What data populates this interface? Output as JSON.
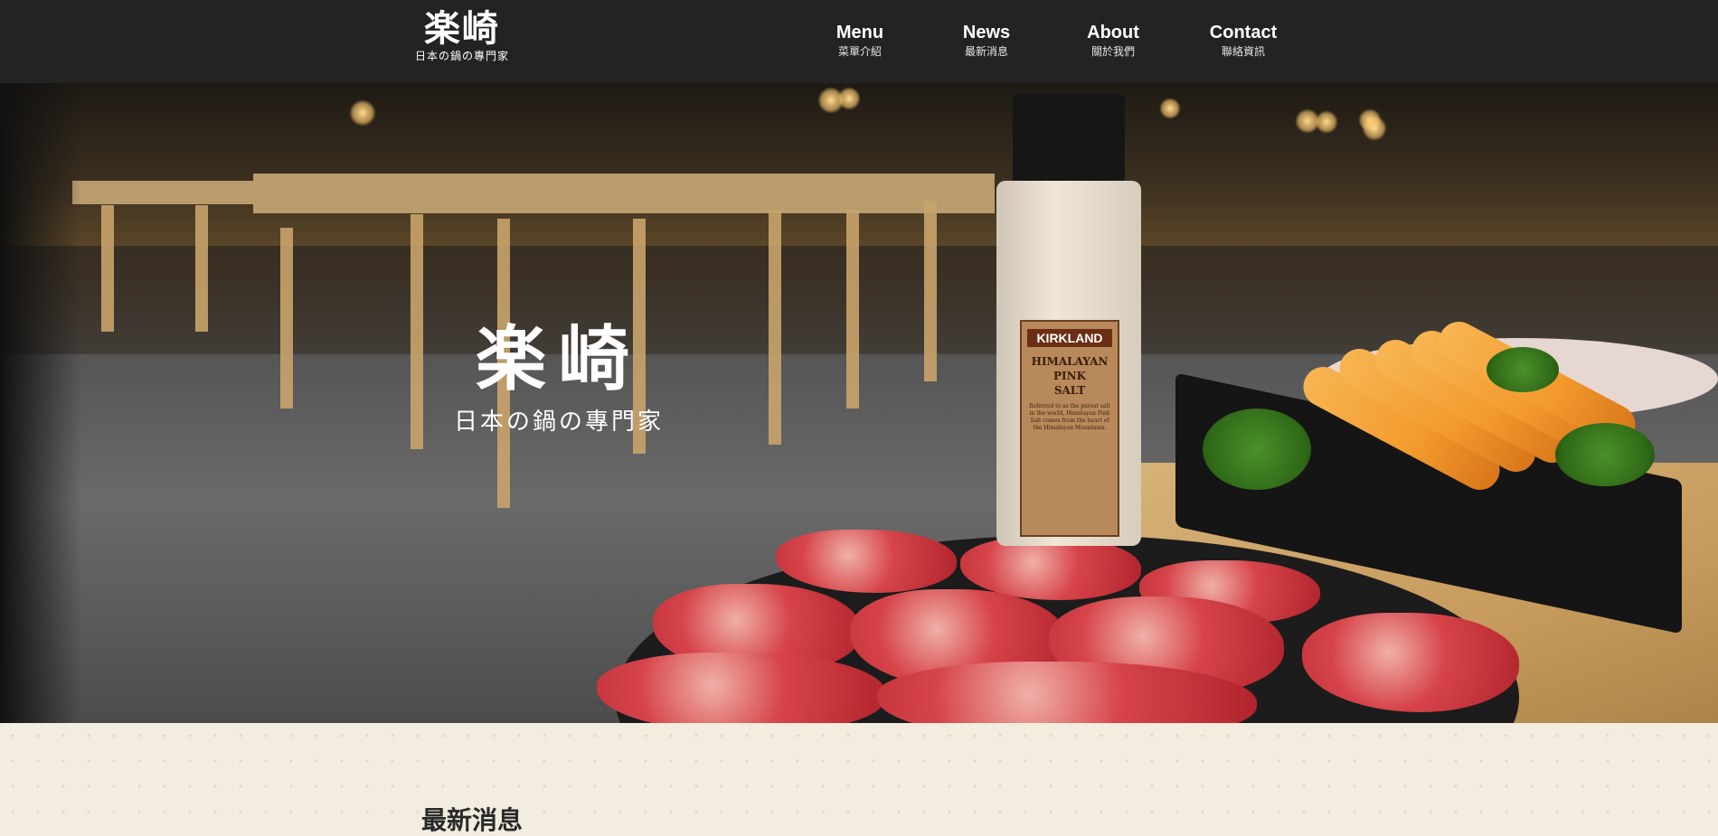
{
  "header": {
    "logo": {
      "title": "楽崎",
      "subtitle": "日本の鍋の專門家"
    },
    "nav": [
      {
        "en": "Menu",
        "zh": "菜單介紹"
      },
      {
        "en": "News",
        "zh": "最新消息"
      },
      {
        "en": "About",
        "zh": "關於我們"
      },
      {
        "en": "Contact",
        "zh": "聯絡資訊"
      }
    ]
  },
  "hero": {
    "logo_title": "楽崎",
    "logo_subtitle": "日本の鍋の專門家",
    "bottle": {
      "brand": "KIRKLAND",
      "product_line1": "HIMALAYAN",
      "product_line2": "PINK",
      "product_line3": "SALT",
      "description": "Referred to as the purest salt in the world, Himalayan Pink Salt comes from the heart of the Himalayan Mountains."
    }
  },
  "section": {
    "title": "最新消息"
  }
}
